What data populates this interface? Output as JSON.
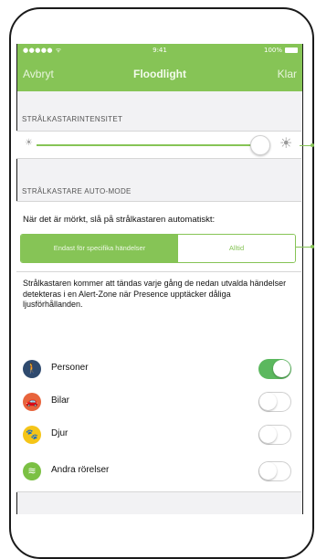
{
  "status": {
    "left": "●●●●● ᯤ",
    "time": "9:41",
    "battery": "100%"
  },
  "nav": {
    "cancel": "Avbryt",
    "title": "Floodlight",
    "done": "Klar"
  },
  "intensity": {
    "header": "STRÅLKASTARINTENSITET",
    "level": 0.92
  },
  "auto": {
    "header": "STRÅLKASTARE AUTO-MODE",
    "text": "När det är mörkt, slå på strålkastaren automatiskt:",
    "segment_left": "Endast för specifika händelser",
    "segment_right": "Alltid",
    "description": "Strålkastaren kommer att tändas varje gång de nedan utvalda händelser detekteras i en Alert-Zone när Presence upptäcker dåliga ljusförhållanden."
  },
  "events": [
    {
      "label": "Personer",
      "icon": "person-walking-icon",
      "color": "#2f4a6e",
      "enabled": true
    },
    {
      "label": "Bilar",
      "icon": "car-icon",
      "color": "#e8643c",
      "enabled": false
    },
    {
      "label": "Djur",
      "icon": "paw-icon",
      "color": "#f5c518",
      "enabled": false
    },
    {
      "label": "Andra rörelser",
      "icon": "motion-icon",
      "color": "#7bc043",
      "enabled": false
    }
  ],
  "colors": {
    "accent": "#86c456",
    "toggle_on": "#5bb85e"
  }
}
